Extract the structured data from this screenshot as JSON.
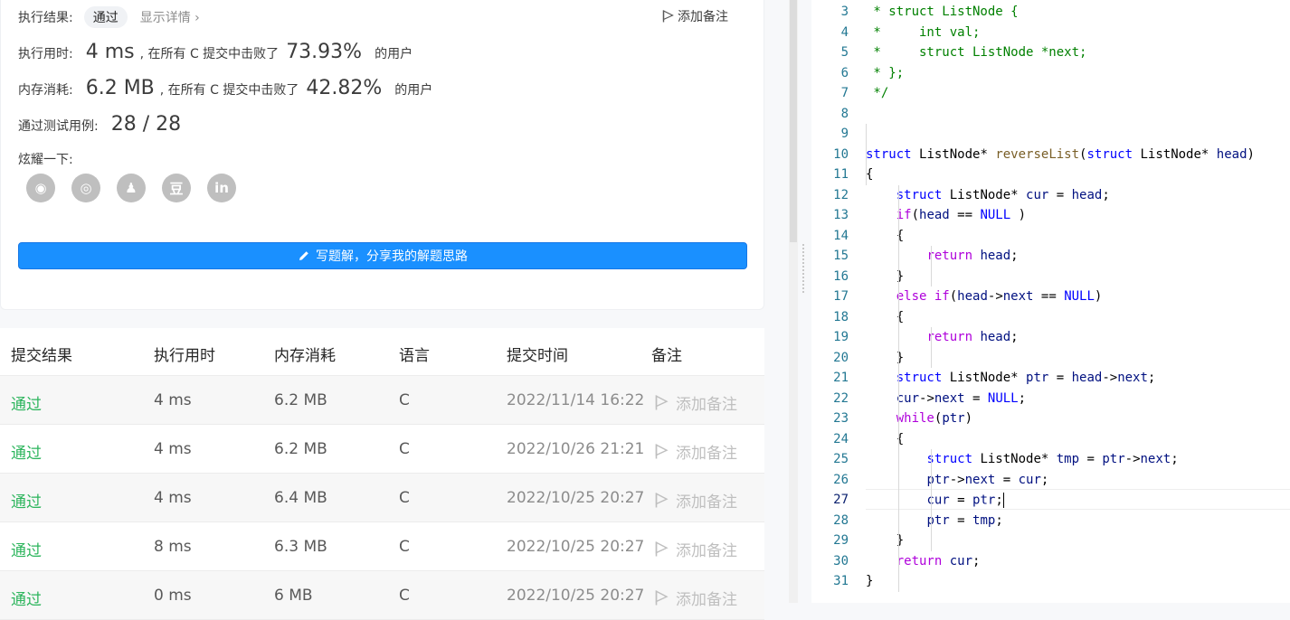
{
  "result": {
    "label": "执行结果:",
    "status": "通过",
    "detail": "显示详情 ›",
    "add_note": "添加备注"
  },
  "runtime": {
    "label": "执行用时:",
    "value": "4 ms",
    "mid": ", 在所有 C 提交中击败了",
    "percent": "73.93%",
    "tail": "的用户"
  },
  "memory": {
    "label": "内存消耗:",
    "value": "6.2 MB",
    "mid": ", 在所有 C 提交中击败了",
    "percent": "42.82%",
    "tail": "的用户"
  },
  "tests": {
    "label": "通过测试用例:",
    "value": "28  /  28"
  },
  "share": {
    "label": "炫耀一下:",
    "icons": [
      "wechat-icon",
      "weibo-icon",
      "qq-icon",
      "douban-icon",
      "linkedin-icon"
    ],
    "glyphs": [
      "◉",
      "◎",
      "♟",
      "豆",
      "in"
    ]
  },
  "write_button": "写题解，分享我的解题思路",
  "table": {
    "headers": [
      "提交结果",
      "执行用时",
      "内存消耗",
      "语言",
      "提交时间",
      "备注"
    ],
    "rows": [
      {
        "status": "通过",
        "time": "4 ms",
        "mem": "6.2 MB",
        "lang": "C",
        "date": "2022/11/14 16:22",
        "note": "添加备注"
      },
      {
        "status": "通过",
        "time": "4 ms",
        "mem": "6.2 MB",
        "lang": "C",
        "date": "2022/10/26 21:21",
        "note": "添加备注"
      },
      {
        "status": "通过",
        "time": "4 ms",
        "mem": "6.4 MB",
        "lang": "C",
        "date": "2022/10/25 20:27",
        "note": "添加备注"
      },
      {
        "status": "通过",
        "time": "8 ms",
        "mem": "6.3 MB",
        "lang": "C",
        "date": "2022/10/25 20:27",
        "note": "添加备注"
      },
      {
        "status": "通过",
        "time": "0 ms",
        "mem": "6 MB",
        "lang": "C",
        "date": "2022/10/25 20:27",
        "note": "添加备注"
      }
    ]
  },
  "editor": {
    "current_line": 27,
    "lines": [
      {
        "n": "3",
        "t": " * struct ListNode {"
      },
      {
        "n": "4",
        "t": " *     int val;"
      },
      {
        "n": "5",
        "t": " *     struct ListNode *next;"
      },
      {
        "n": "6",
        "t": " * };"
      },
      {
        "n": "7",
        "t": " */"
      },
      {
        "n": "8",
        "t": ""
      },
      {
        "n": "9",
        "t": ""
      },
      {
        "n": "10",
        "t": "struct ListNode* reverseList(struct ListNode* head)"
      },
      {
        "n": "11",
        "t": "{"
      },
      {
        "n": "12",
        "t": "    struct ListNode* cur = head;"
      },
      {
        "n": "13",
        "t": "    if(head == NULL )"
      },
      {
        "n": "14",
        "t": "    {"
      },
      {
        "n": "15",
        "t": "        return head;"
      },
      {
        "n": "16",
        "t": "    }"
      },
      {
        "n": "17",
        "t": "    else if(head->next == NULL)"
      },
      {
        "n": "18",
        "t": "    {"
      },
      {
        "n": "19",
        "t": "        return head;"
      },
      {
        "n": "20",
        "t": "    }"
      },
      {
        "n": "21",
        "t": "    struct ListNode* ptr = head->next;"
      },
      {
        "n": "22",
        "t": "    cur->next = NULL;"
      },
      {
        "n": "23",
        "t": "    while(ptr)"
      },
      {
        "n": "24",
        "t": "    {"
      },
      {
        "n": "25",
        "t": "        struct ListNode* tmp = ptr->next;"
      },
      {
        "n": "26",
        "t": "        ptr->next = cur;"
      },
      {
        "n": "27",
        "t": "        cur = ptr;"
      },
      {
        "n": "28",
        "t": "        ptr = tmp;"
      },
      {
        "n": "29",
        "t": "    }"
      },
      {
        "n": "30",
        "t": "    return cur;"
      },
      {
        "n": "31",
        "t": "}"
      }
    ]
  },
  "colors": {
    "accent": "#1a90ff",
    "pass": "#2db55d",
    "line_number": "#237893"
  }
}
